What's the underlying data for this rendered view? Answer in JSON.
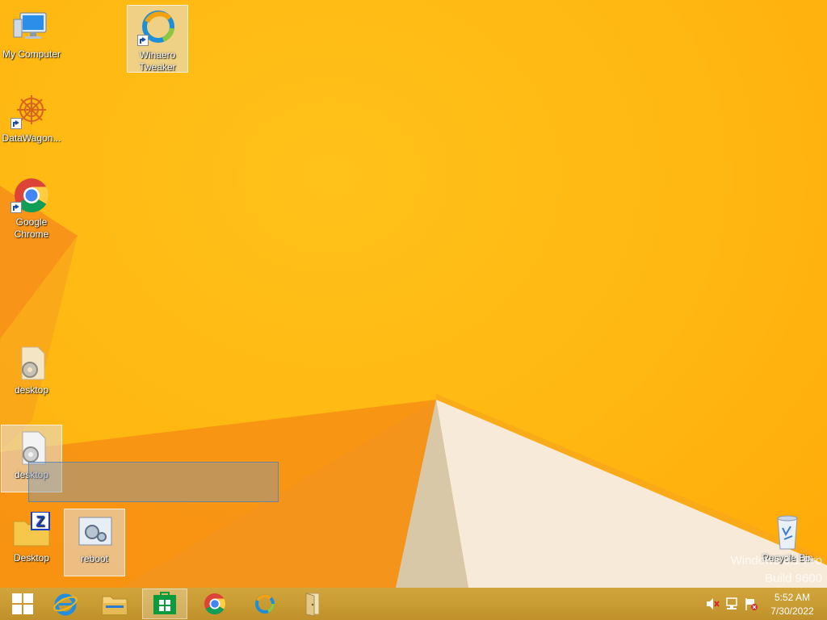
{
  "desktop_icons": [
    {
      "id": "my-computer",
      "label": "My Computer"
    },
    {
      "id": "winaero-tweaker",
      "label": "Winaero Tweaker"
    },
    {
      "id": "datawagon",
      "label": "DataWagon..."
    },
    {
      "id": "google-chrome",
      "label": "Google Chrome"
    },
    {
      "id": "desktop-file-1",
      "label": "desktop"
    },
    {
      "id": "desktop-file-2",
      "label": "desktop"
    },
    {
      "id": "desktop-folder",
      "label": "Desktop"
    },
    {
      "id": "reboot",
      "label": "reboot"
    },
    {
      "id": "recycle-bin",
      "label": "Recycle Bin"
    }
  ],
  "watermark": {
    "line1": "Windows 8.1 Pro",
    "line2": "Build 9600"
  },
  "taskbar": {
    "buttons": [
      {
        "name": "start-icon"
      },
      {
        "name": "internet-explorer-icon"
      },
      {
        "name": "file-explorer-icon"
      },
      {
        "name": "store-icon",
        "active": true
      },
      {
        "name": "chrome-icon"
      },
      {
        "name": "winaero-tweaker-icon"
      },
      {
        "name": "door-icon"
      }
    ],
    "tray": [
      "speaker-muted-icon",
      "network-icon",
      "action-center-icon"
    ]
  },
  "clock": {
    "time": "5:52 AM",
    "date": "7/30/2022"
  },
  "colors": {
    "wallpaper": "#ffb711",
    "taskbar": "#c89a2e"
  }
}
